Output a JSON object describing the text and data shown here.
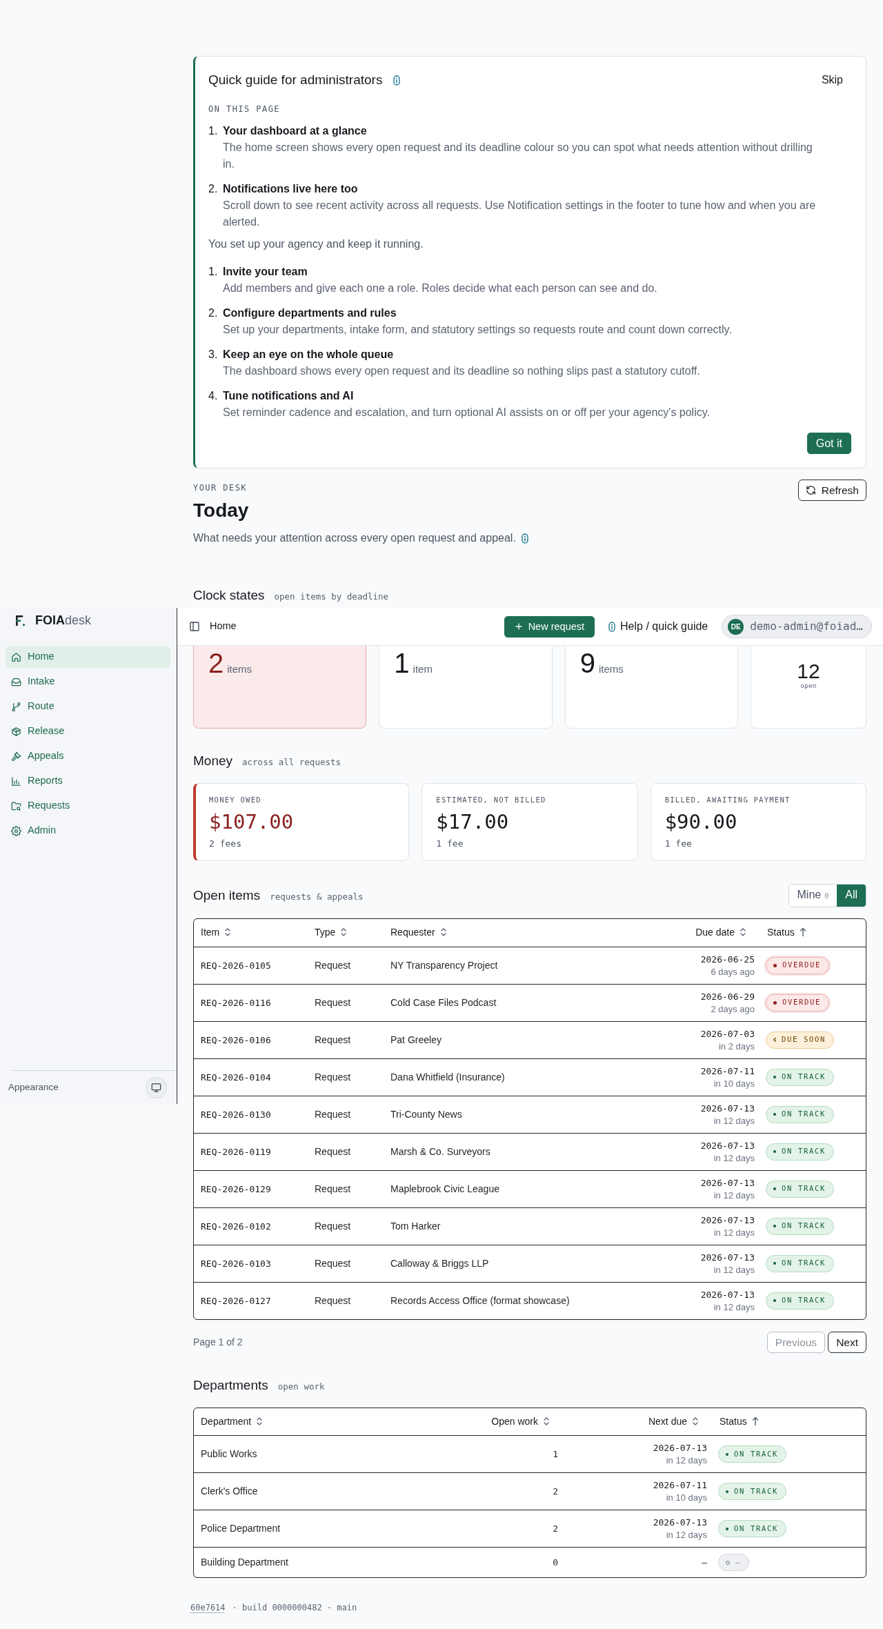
{
  "sidebar": {
    "brand": "**FOIA**desk",
    "items": [
      {
        "label": "Home",
        "selected": true
      },
      {
        "label": "Intake",
        "selected": false
      },
      {
        "label": "Route",
        "selected": false
      },
      {
        "label": "Release",
        "selected": false
      },
      {
        "label": "Appeals",
        "selected": false
      },
      {
        "label": "Reports",
        "selected": false
      },
      {
        "label": "Requests",
        "selected": false
      },
      {
        "label": "Admin",
        "selected": false
      }
    ],
    "appearance_label": "Appearance"
  },
  "topbar": {
    "breadcrumb": "Home",
    "new_request_button": "New request",
    "help_link": "Help / quick guide",
    "user": {
      "initials": "DE",
      "email": "demo-admin@foiad…"
    }
  },
  "guide": {
    "title": "Quick guide for administrators",
    "skip_button": "Skip",
    "section_label": "ON THIS PAGE",
    "page_steps": [
      {
        "number": "1.",
        "title": "Your dashboard at a glance",
        "text": "The home screen shows every open request and its deadline colour so you can spot what needs attention without drilling in."
      },
      {
        "number": "2.",
        "title": "Notifications live here too",
        "text": "Scroll down to see recent activity across all requests. Use Notification settings in the footer to tune how and when you are alerted."
      }
    ],
    "intro": "You set up your agency and keep it running.",
    "role_steps": [
      {
        "number": "1.",
        "title": "Invite your team",
        "text": "Add members and give each one a role. Roles decide what each person can see and do."
      },
      {
        "number": "2.",
        "title": "Configure departments and rules",
        "text": "Set up your departments, intake form, and statutory settings so requests route and count down correctly."
      },
      {
        "number": "3.",
        "title": "Keep an eye on the whole queue",
        "text": "The dashboard shows every open request and its deadline so nothing slips past a statutory cutoff."
      },
      {
        "number": "4.",
        "title": "Tune notifications and AI",
        "text": "Set reminder cadence and escalation, and turn optional AI assists on or off per your agency's policy."
      }
    ],
    "done_button": "Got it"
  },
  "header": {
    "eyebrow": "YOUR DESK",
    "title": "Today",
    "subtitle": "What needs your attention across every open request and appeal.",
    "refresh_button": "Refresh"
  },
  "clock_states": {
    "title": "Clock states",
    "caption": "open items by deadline",
    "cards": [
      {
        "kind": "count",
        "alert": true,
        "value": "2",
        "unit": "items"
      },
      {
        "kind": "count",
        "alert": false,
        "value": "1",
        "unit": "item"
      },
      {
        "kind": "count",
        "alert": false,
        "value": "9",
        "unit": "items"
      },
      {
        "kind": "total",
        "alert": false,
        "value": "12",
        "unit": "open"
      }
    ]
  },
  "money": {
    "title": "Money",
    "caption": "across all requests",
    "cards": [
      {
        "label": "MONEY OWED",
        "amount": "$107.00",
        "note": "2 fees",
        "alert": true
      },
      {
        "label": "ESTIMATED, NOT BILLED",
        "amount": "$17.00",
        "note": "1 fee",
        "alert": false
      },
      {
        "label": "BILLED, AWAITING PAYMENT",
        "amount": "$90.00",
        "note": "1 fee",
        "alert": false
      }
    ]
  },
  "open_items": {
    "title": "Open items",
    "caption": "requests & appeals",
    "filters": [
      {
        "label": "Mine",
        "count": "0",
        "selected": false
      },
      {
        "label": "All",
        "selected": true
      }
    ],
    "columns": [
      {
        "label": "Item",
        "sorted": false
      },
      {
        "label": "Type",
        "sorted": false
      },
      {
        "label": "Requester",
        "sorted": false
      },
      {
        "label": "Due date",
        "sorted": false
      },
      {
        "label": "Status",
        "sorted": true
      }
    ],
    "rows": [
      {
        "item": "REQ-2026-0105",
        "type": "Request",
        "requester": "NY Transparency Project",
        "due_date": "2026-06-25",
        "due_relative": "6 days ago",
        "status": {
          "kind": "overdue",
          "label": "OVERDUE"
        }
      },
      {
        "item": "REQ-2026-0116",
        "type": "Request",
        "requester": "Cold Case Files Podcast",
        "due_date": "2026-06-29",
        "due_relative": "2 days ago",
        "status": {
          "kind": "overdue",
          "label": "OVERDUE"
        }
      },
      {
        "item": "REQ-2026-0106",
        "type": "Request",
        "requester": "Pat Greeley",
        "due_date": "2026-07-03",
        "due_relative": "in 2 days",
        "status": {
          "kind": "due_soon",
          "label": "DUE SOON"
        }
      },
      {
        "item": "REQ-2026-0104",
        "type": "Request",
        "requester": "Dana Whitfield (Insurance)",
        "due_date": "2026-07-11",
        "due_relative": "in 10 days",
        "status": {
          "kind": "on_track",
          "label": "ON TRACK"
        }
      },
      {
        "item": "REQ-2026-0130",
        "type": "Request",
        "requester": "Tri-County News",
        "due_date": "2026-07-13",
        "due_relative": "in 12 days",
        "status": {
          "kind": "on_track",
          "label": "ON TRACK"
        }
      },
      {
        "item": "REQ-2026-0119",
        "type": "Request",
        "requester": "Marsh & Co. Surveyors",
        "due_date": "2026-07-13",
        "due_relative": "in 12 days",
        "status": {
          "kind": "on_track",
          "label": "ON TRACK"
        }
      },
      {
        "item": "REQ-2026-0129",
        "type": "Request",
        "requester": "Maplebrook Civic League",
        "due_date": "2026-07-13",
        "due_relative": "in 12 days",
        "status": {
          "kind": "on_track",
          "label": "ON TRACK"
        }
      },
      {
        "item": "REQ-2026-0102",
        "type": "Request",
        "requester": "Tom Harker",
        "due_date": "2026-07-13",
        "due_relative": "in 12 days",
        "status": {
          "kind": "on_track",
          "label": "ON TRACK"
        }
      },
      {
        "item": "REQ-2026-0103",
        "type": "Request",
        "requester": "Calloway & Briggs LLP",
        "due_date": "2026-07-13",
        "due_relative": "in 12 days",
        "status": {
          "kind": "on_track",
          "label": "ON TRACK"
        }
      },
      {
        "item": "REQ-2026-0127",
        "type": "Request",
        "requester": "Records Access Office (format showcase)",
        "due_date": "2026-07-13",
        "due_relative": "in 12 days",
        "status": {
          "kind": "on_track",
          "label": "ON TRACK"
        }
      }
    ],
    "pagination": {
      "summary": "Page 1 of 2",
      "buttons": [
        {
          "label": "Previous",
          "disabled": true
        },
        {
          "label": "Next",
          "disabled": false
        }
      ]
    }
  },
  "departments": {
    "title": "Departments",
    "caption": "open work",
    "columns": [
      {
        "label": "Department",
        "sorted": false
      },
      {
        "label": "Open work",
        "sorted": false
      },
      {
        "label": "Next due",
        "sorted": false
      },
      {
        "label": "Status",
        "sorted": true
      }
    ],
    "rows": [
      {
        "name": "Public Works",
        "open_work": "1",
        "next_due": "2026-07-13",
        "due_relative": "in 12 days",
        "status": {
          "kind": "on_track",
          "label": "ON TRACK"
        }
      },
      {
        "name": "Clerk's Office",
        "open_work": "2",
        "next_due": "2026-07-11",
        "due_relative": "in 10 days",
        "status": {
          "kind": "on_track",
          "label": "ON TRACK"
        }
      },
      {
        "name": "Police Department",
        "open_work": "2",
        "next_due": "2026-07-13",
        "due_relative": "in 12 days",
        "status": {
          "kind": "on_track",
          "label": "ON TRACK"
        }
      },
      {
        "name": "Building Department",
        "open_work": "0",
        "next_due": "—",
        "status": {
          "kind": "none",
          "label": "—"
        }
      }
    ]
  },
  "footer": {
    "commit": "60e7614",
    "details": "· build 0000000482 · main"
  }
}
